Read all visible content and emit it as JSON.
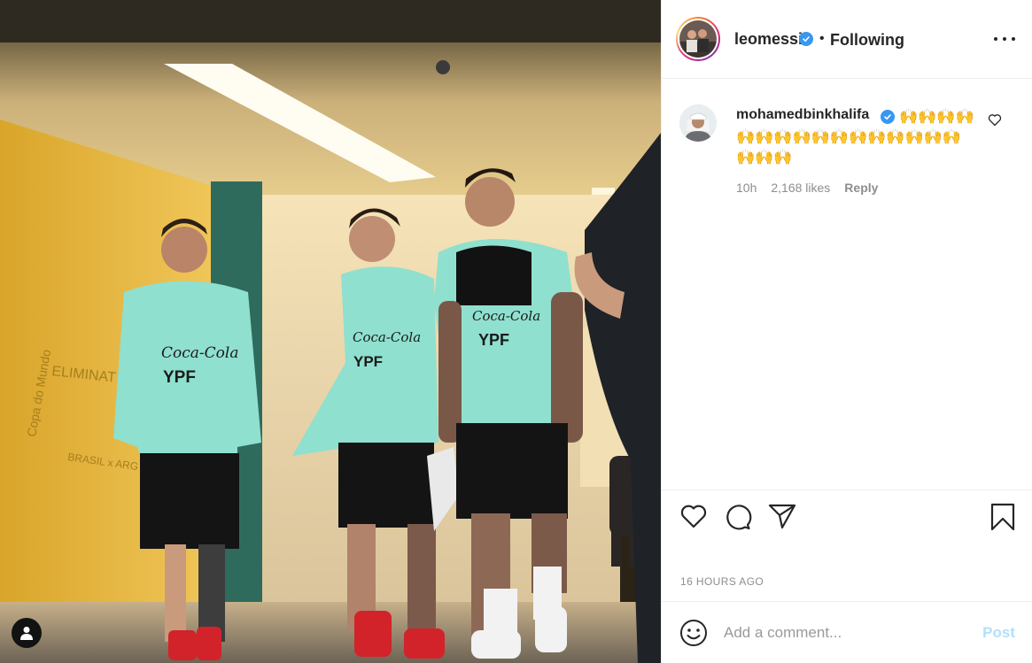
{
  "post": {
    "author": "leomessi",
    "follow_state": "Following",
    "separator": "•",
    "posted_ago": "16 HOURS AGO",
    "image_text": {
      "sponsor": "Coca-Cola",
      "brand": "YPF",
      "wall_text": "ELIMINAT",
      "wall_text_2": "Copa do Mundo",
      "wall_text_3": "BRASIL x ARG"
    }
  },
  "comments": [
    {
      "username": "mohamedbinkhalifa",
      "text": "🙌🙌🙌🙌🙌🙌🙌🙌🙌🙌🙌🙌🙌🙌🙌🙌🙌🙌🙌",
      "time": "10h",
      "likes": "2,168 likes",
      "reply_label": "Reply"
    }
  ],
  "composer": {
    "placeholder": "Add a comment...",
    "post_label": "Post"
  },
  "colors": {
    "verified": "#3897f0",
    "post_disabled": "#b2dffc",
    "meta_gray": "#8e8e8e",
    "jersey": "#8fe0cf",
    "wall_yellow": "#e9b83b"
  },
  "icons": [
    "user-tag-icon",
    "verified-icon",
    "more-options-icon",
    "heart-icon",
    "comment-icon",
    "share-icon",
    "bookmark-icon",
    "emoji-icon"
  ]
}
